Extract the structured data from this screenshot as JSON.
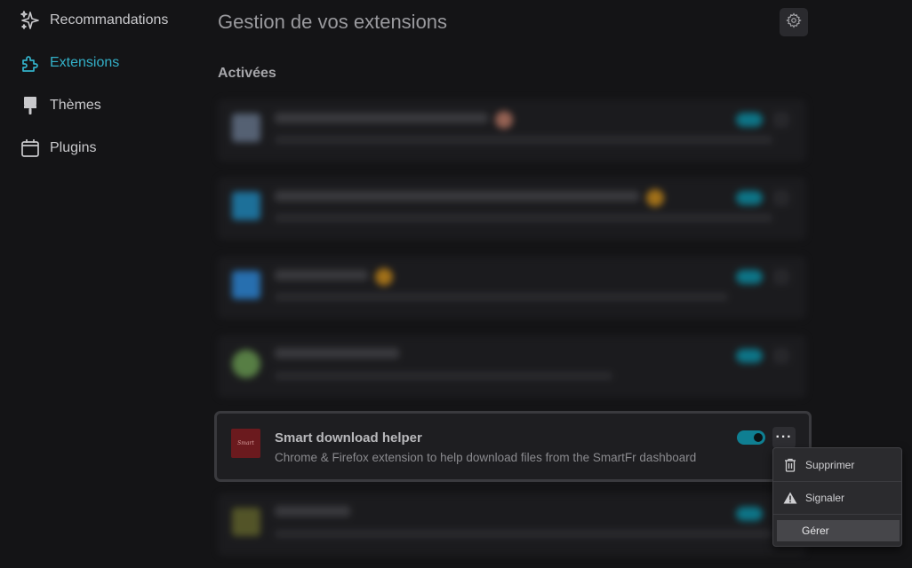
{
  "sidebar": {
    "items": [
      {
        "label": "Recommandations",
        "icon": "sparkles-icon",
        "active": false
      },
      {
        "label": "Extensions",
        "icon": "puzzle-icon",
        "active": true
      },
      {
        "label": "Thèmes",
        "icon": "paintbrush-icon",
        "active": false
      },
      {
        "label": "Plugins",
        "icon": "calendar-plugin-icon",
        "active": false
      }
    ]
  },
  "header": {
    "title": "Gestion de vos extensions",
    "settings_icon": "gear-icon"
  },
  "section": {
    "title": "Activées"
  },
  "focused_extension": {
    "name": "Smart download helper",
    "description": "Chrome & Firefox extension to help download files from the SmartFr dashboard",
    "enabled": true,
    "more_label": "···"
  },
  "context_menu": {
    "items": [
      {
        "label": "Supprimer",
        "icon": "trash-icon"
      },
      {
        "label": "Signaler",
        "icon": "warning-icon"
      },
      {
        "label": "Gérer",
        "icon": ""
      }
    ]
  },
  "colors": {
    "accent": "#33b1c9",
    "toggle_on": "#0f7f92",
    "background": "#141416",
    "extension_icon": "#6b1a1e"
  }
}
